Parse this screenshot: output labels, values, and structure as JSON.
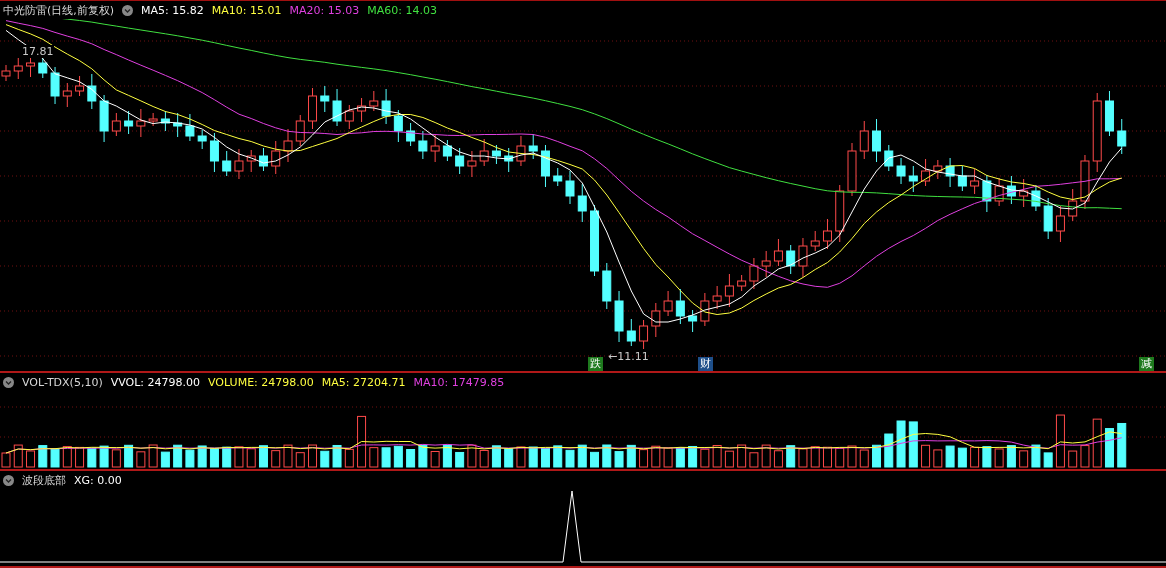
{
  "main_panel": {
    "title": "中光防雷(日线,前复权)",
    "indicators": [
      {
        "label": "MA5: 15.82",
        "color": "#ffffff"
      },
      {
        "label": "MA10: 15.01",
        "color": "#ffff40"
      },
      {
        "label": "MA20: 15.03",
        "color": "#e040e0"
      },
      {
        "label": "MA60: 14.03",
        "color": "#40e040"
      }
    ],
    "high_label": "17.81",
    "low_label": "←11.11",
    "events": [
      {
        "label": "跌",
        "color": "#1e7a1e"
      },
      {
        "label": "财",
        "color": "#1e4f8a"
      },
      {
        "label": "减",
        "color": "#1e7a1e"
      }
    ]
  },
  "volume_panel": {
    "title": "VOL-TDX(5,10)",
    "indicators": [
      {
        "label": "VVOL: 24798.00",
        "color": "#ffffff"
      },
      {
        "label": "VOLUME: 24798.00",
        "color": "#ffff40"
      },
      {
        "label": "MA5: 27204.71",
        "color": "#ffff40"
      },
      {
        "label": "MA10: 17479.85",
        "color": "#e040e0"
      }
    ]
  },
  "signal_panel": {
    "title": "波段底部",
    "indicators": [
      {
        "label": "XG: 0.00",
        "color": "#ffffff"
      }
    ]
  }
}
